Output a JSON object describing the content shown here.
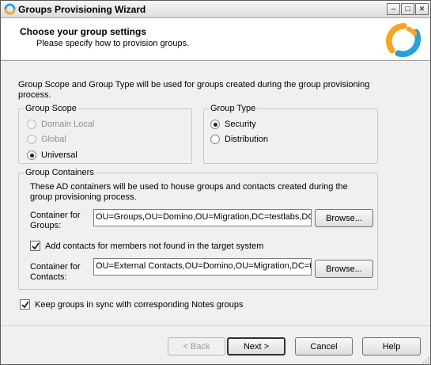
{
  "window": {
    "title": "Groups Provisioning Wizard",
    "min_glyph": "–",
    "max_glyph": "□",
    "close_glyph": "✕"
  },
  "header": {
    "title": "Choose your group settings",
    "subtitle": "Please specify how to provision groups."
  },
  "intro": "Group Scope and Group Type will be used for groups created during the group provisioning process.",
  "group_scope": {
    "legend": "Group Scope",
    "options": [
      {
        "label": "Domain Local",
        "checked": false,
        "enabled": false
      },
      {
        "label": "Global",
        "checked": false,
        "enabled": false
      },
      {
        "label": "Universal",
        "checked": true,
        "enabled": true
      }
    ]
  },
  "group_type": {
    "legend": "Group Type",
    "options": [
      {
        "label": "Security",
        "checked": true
      },
      {
        "label": "Distribution",
        "checked": false
      }
    ]
  },
  "containers": {
    "legend": "Group Containers",
    "description": "These AD containers will be used to house groups and contacts created during the group provisioning process.",
    "groups_label": "Container for\nGroups:",
    "groups_value": "OU=Groups,OU=Domino,OU=Migration,DC=testlabs,DC=com",
    "browse_label": "Browse...",
    "add_contacts_label": "Add contacts for members not found in the target system",
    "add_contacts_checked": true,
    "contacts_label": "Container for\nContacts:",
    "contacts_value": "OU=External Contacts,OU=Domino,OU=Migration,DC=testlabs,DC=com"
  },
  "sync": {
    "label": "Keep groups in sync with corresponding Notes groups",
    "checked": true
  },
  "footer": {
    "back": "< Back",
    "next": "Next >",
    "cancel": "Cancel",
    "help": "Help"
  },
  "colors": {
    "logo_orange": "#f5a623",
    "logo_blue": "#2a9fd8"
  }
}
